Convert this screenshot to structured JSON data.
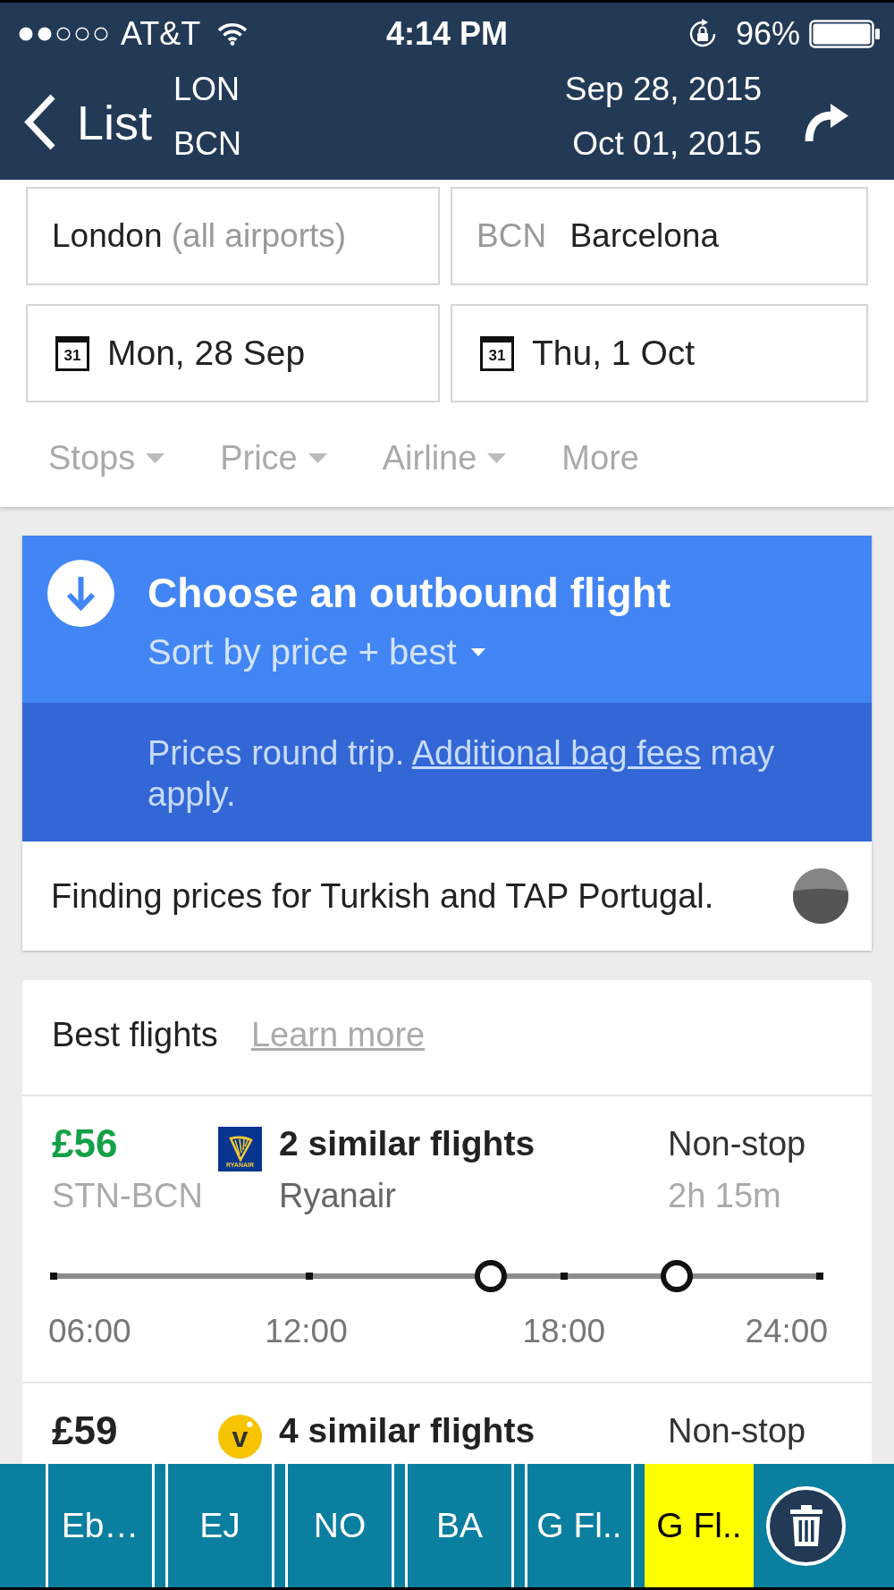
{
  "status_bar": {
    "carrier": "AT&T",
    "time": "4:14 PM",
    "battery": "96%"
  },
  "nav_bar": {
    "back": "List",
    "origin": "LON",
    "destination": "BCN",
    "depart_date": "Sep 28, 2015",
    "return_date": "Oct 01, 2015"
  },
  "search": {
    "fields": [
      {
        "kind": "place",
        "value": "London",
        "hint": "(all airports)"
      },
      {
        "kind": "place",
        "code": "BCN",
        "value": "Barcelona"
      },
      {
        "kind": "date",
        "icon_day": "31",
        "value": "Mon, 28 Sep"
      },
      {
        "kind": "date",
        "icon_day": "31",
        "value": "Thu, 1 Oct"
      }
    ],
    "filters": [
      {
        "label": "Stops",
        "dropdown": true
      },
      {
        "label": "Price",
        "dropdown": true
      },
      {
        "label": "Airline",
        "dropdown": true
      },
      {
        "label": "More",
        "dropdown": false
      }
    ]
  },
  "outbound": {
    "title": "Choose an outbound flight",
    "sort": "Sort by price + best",
    "notice": {
      "text": "Prices round trip.",
      "link": "Additional bag fees",
      "after": "may apply."
    },
    "status": "Finding prices for Turkish and TAP Portugal."
  },
  "results": {
    "title": "Best flights",
    "link": "Learn more",
    "flights": [
      {
        "price": "£56",
        "best_price": true,
        "route": "STN-BCN",
        "logo": {
          "kind": "tile",
          "text": "RYANAIR"
        },
        "summary": "2 similar flights",
        "airline": "Ryanair",
        "stops": "Non-stop",
        "duration": "2h 15m",
        "timeline": {
          "ticks": [
            "06:00",
            "12:00",
            "18:00",
            "24:00"
          ],
          "markers": [
            {
              "level": 0.57
            },
            {
              "level": 0.81
            }
          ]
        }
      },
      {
        "price": "£59",
        "best_price": false,
        "logo": {
          "kind": "disc",
          "text": "v"
        },
        "summary": "4 similar flights",
        "stops": "Non-stop"
      }
    ]
  },
  "tabs": {
    "items": [
      {
        "label": "Eb…",
        "selected": false
      },
      {
        "label": "EJ",
        "selected": false
      },
      {
        "label": "NO",
        "selected": false
      },
      {
        "label": "BA",
        "selected": false
      },
      {
        "label": "G Fl..",
        "selected": false
      },
      {
        "label": "G Fl..",
        "selected": true
      }
    ]
  }
}
